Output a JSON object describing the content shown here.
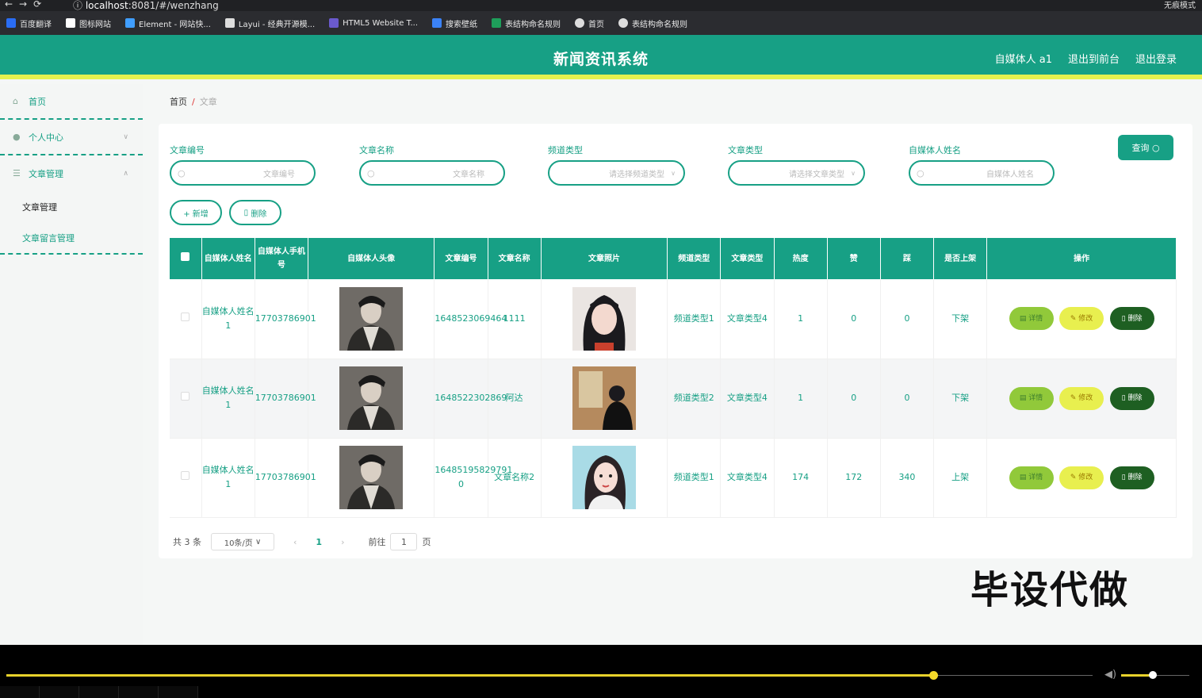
{
  "browser": {
    "url_host": "localhost",
    "url_rest": ":8081/#/wenzhang",
    "right_label": "无痕模式"
  },
  "bookmarks": [
    {
      "label": "百度翻译",
      "color": "#2a6df4"
    },
    {
      "label": "图标网站",
      "color": "#ffffff"
    },
    {
      "label": "Element - 网站快...",
      "color": "#409eff"
    },
    {
      "label": "Layui - 经典开源模...",
      "color": "#dddddd"
    },
    {
      "label": "HTML5 Website T...",
      "color": "#6a5acd"
    },
    {
      "label": "搜索壁纸",
      "color": "#3b82f6"
    },
    {
      "label": "表结构命名规则",
      "color": "#1e9e5a"
    },
    {
      "label": "首页",
      "color": "#dddddd"
    },
    {
      "label": "表结构命名规则",
      "color": "#dddddd"
    }
  ],
  "header": {
    "title": "新闻资讯系统",
    "user": "自媒体人 a1",
    "back": "退出到前台",
    "logout": "退出登录"
  },
  "sidebar": {
    "home": "首页",
    "personal": "个人中心",
    "article_mgmt": "文章管理",
    "sub1": "文章管理",
    "sub2": "文章留言管理"
  },
  "breadcrumb": {
    "home": "首页",
    "sep": "/",
    "current": "文章"
  },
  "filters": [
    {
      "label": "文章编号",
      "placeholder": "文章编号"
    },
    {
      "label": "文章名称",
      "placeholder": "文章名称"
    },
    {
      "label": "频道类型",
      "placeholder": "请选择频道类型"
    },
    {
      "label": "文章类型",
      "placeholder": "请选择文章类型"
    },
    {
      "label": "自媒体人姓名",
      "placeholder": "自媒体人姓名"
    }
  ],
  "buttons": {
    "query": "查询",
    "add": "+ 新增",
    "delete": "删除"
  },
  "columns": [
    "自媒体人姓名",
    "自媒体人手机号",
    "自媒体人头像",
    "文章编号",
    "文章名称",
    "文章照片",
    "频道类型",
    "文章类型",
    "热度",
    "赞",
    "踩",
    "是否上架",
    "操作"
  ],
  "rows": [
    {
      "name": "自媒体人姓名1",
      "phone": "17703786901",
      "no": "1648523069464",
      "title": "1111",
      "channel": "频道类型1",
      "type": "文章类型4",
      "heat": "1",
      "like": "0",
      "dislike": "0",
      "status": "下架"
    },
    {
      "name": "自媒体人姓名1",
      "phone": "17703786901",
      "no": "1648522302869",
      "title": "阿达",
      "channel": "频道类型2",
      "type": "文章类型4",
      "heat": "1",
      "like": "0",
      "dislike": "0",
      "status": "下架"
    },
    {
      "name": "自媒体人姓名1",
      "phone": "17703786901",
      "no": "16485195829791 0",
      "title": "文章名称2",
      "channel": "频道类型1",
      "type": "文章类型4",
      "heat": "174",
      "like": "172",
      "dislike": "340",
      "status": "上架"
    }
  ],
  "actions": {
    "detail": "详情",
    "edit": "修改",
    "delete": "删除"
  },
  "pager": {
    "total": "共 3 条",
    "size": "10条/页",
    "page": "1",
    "goto": "前往",
    "goto_value": "1",
    "page_unit": "页"
  },
  "watermark": "毕设代做",
  "colors": {
    "primary": "#17a085",
    "accent_bar": "#e5f14e"
  }
}
